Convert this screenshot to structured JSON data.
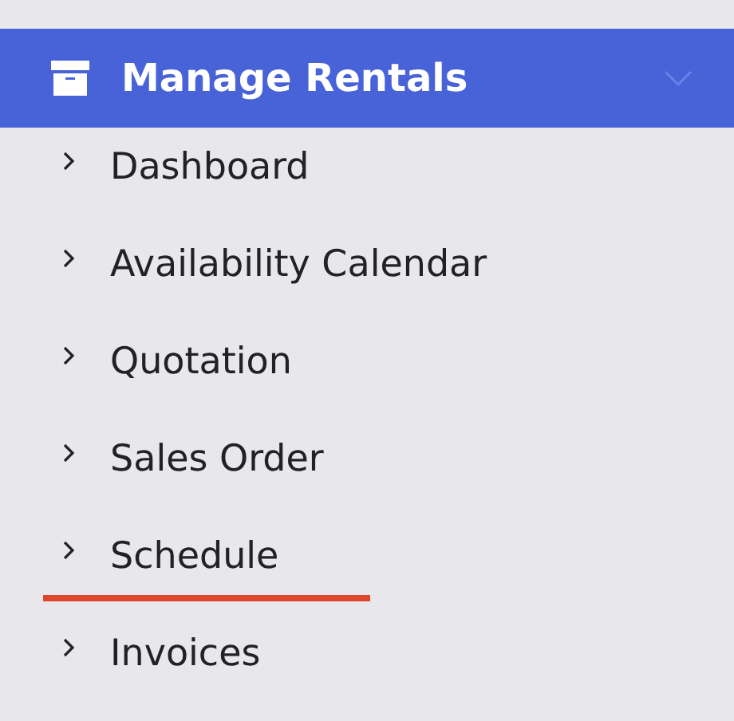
{
  "menu": {
    "title": "Manage Rentals",
    "expanded": true,
    "items": [
      {
        "label": "Dashboard",
        "selected": false
      },
      {
        "label": "Availability Calendar",
        "selected": false
      },
      {
        "label": "Quotation",
        "selected": false
      },
      {
        "label": "Sales Order",
        "selected": false
      },
      {
        "label": "Schedule",
        "selected": true
      },
      {
        "label": "Invoices",
        "selected": false
      }
    ]
  }
}
